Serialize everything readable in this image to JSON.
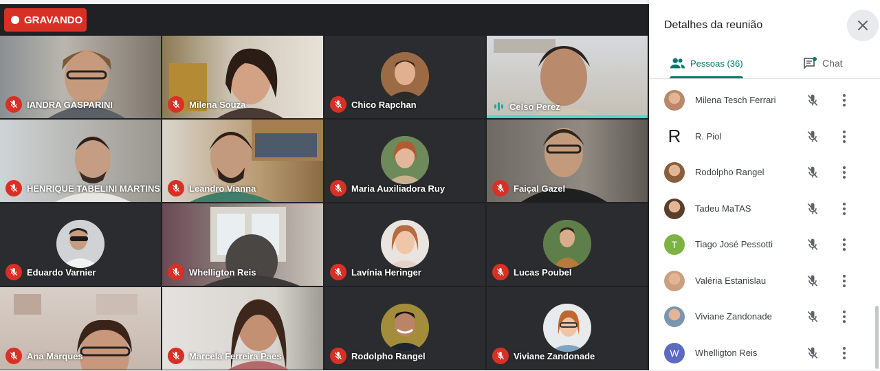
{
  "recording": {
    "label": "GRAVANDO",
    "color": "#d93025"
  },
  "tiles": [
    {
      "name": "IANDRA GASPARINI",
      "muted": true,
      "camera": true
    },
    {
      "name": "Milena Souza",
      "muted": true,
      "camera": true
    },
    {
      "name": "Chico Rapchan",
      "muted": true,
      "camera": false
    },
    {
      "name": "Celso Perez",
      "muted": false,
      "speaking": true,
      "camera": true
    },
    {
      "name": "HENRIQUE TABELINI MARTINS",
      "muted": true,
      "camera": true
    },
    {
      "name": "Leandro Vianna",
      "muted": true,
      "camera": true
    },
    {
      "name": "Maria Auxiliadora Ruy",
      "muted": true,
      "camera": false
    },
    {
      "name": "Faiçal Gazel",
      "muted": true,
      "camera": true
    },
    {
      "name": "Eduardo Varnier",
      "muted": true,
      "camera": false
    },
    {
      "name": "Whelligton Reis",
      "muted": true,
      "camera": true
    },
    {
      "name": "Lavínia Heringer",
      "muted": true,
      "camera": false
    },
    {
      "name": "Lucas Poubel",
      "muted": true,
      "camera": false
    },
    {
      "name": "Ana Marques",
      "muted": true,
      "camera": true
    },
    {
      "name": "Marcela Ferreira Paes",
      "muted": true,
      "camera": true
    },
    {
      "name": "Rodolpho Rangel",
      "muted": true,
      "camera": false
    },
    {
      "name": "Viviane Zandonade",
      "muted": true,
      "camera": false
    }
  ],
  "panel": {
    "title": "Detalhes da reunião",
    "close_icon": "close-icon",
    "tabs": {
      "people": "Pessoas (36)",
      "chat": "Chat"
    },
    "accent": "#00796b",
    "participants": [
      {
        "name": "Milena Tesch Ferrari",
        "avatar": "photo"
      },
      {
        "name": "R. Piol",
        "avatar": "letter",
        "letter": "R"
      },
      {
        "name": "Rodolpho Rangel",
        "avatar": "photo"
      },
      {
        "name": "Tadeu MaTAS",
        "avatar": "photo"
      },
      {
        "name": "Tiago José Pessotti",
        "avatar": "letter",
        "letter": "T",
        "color": "#7cb342"
      },
      {
        "name": "Valéria Estanislau",
        "avatar": "photo"
      },
      {
        "name": "Viviane Zandonade",
        "avatar": "photo"
      },
      {
        "name": "Whelligton Reis",
        "avatar": "letter",
        "letter": "W",
        "color": "#5c6bc0"
      }
    ]
  }
}
